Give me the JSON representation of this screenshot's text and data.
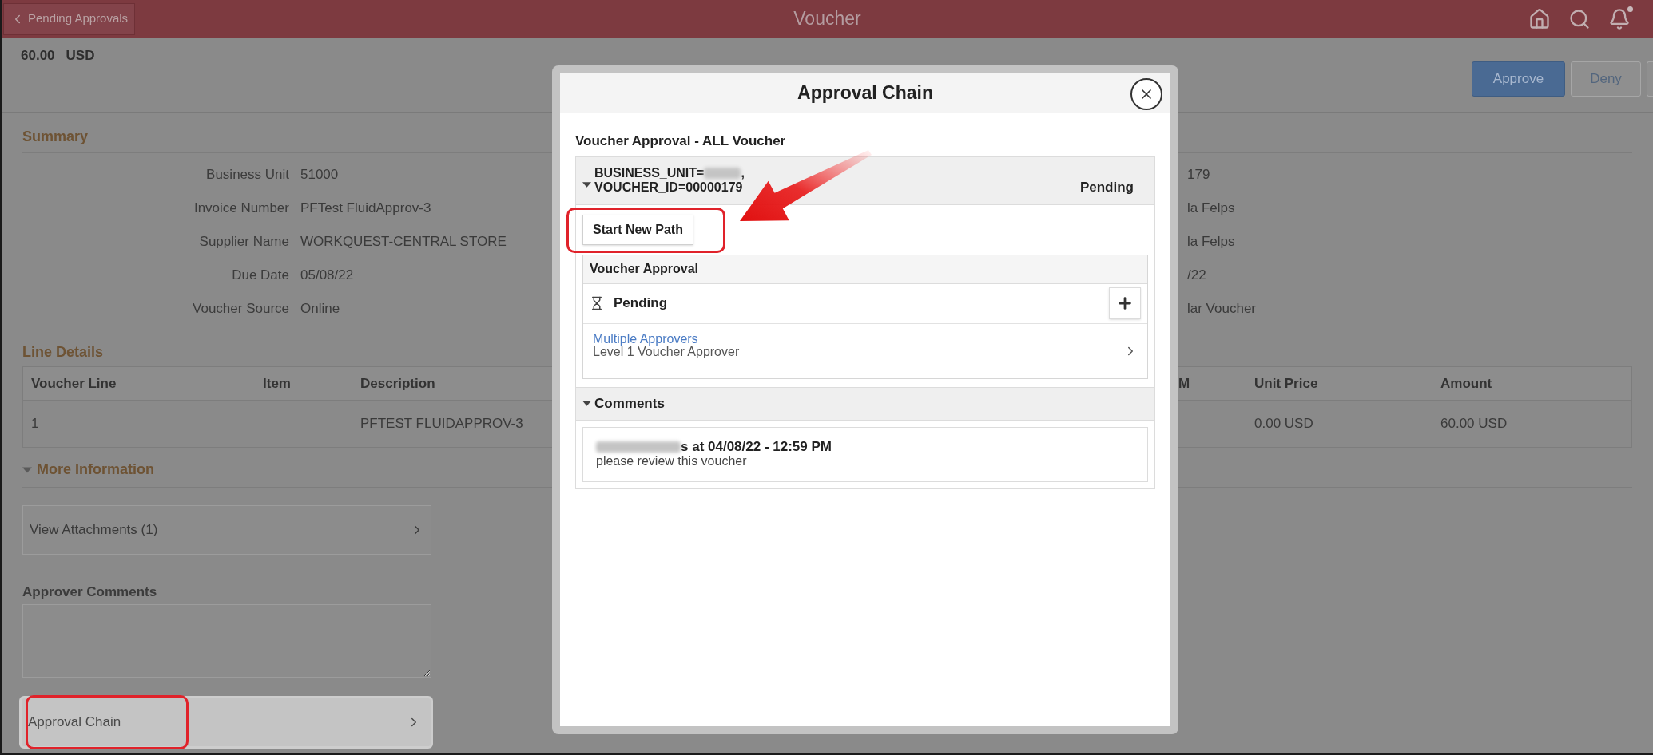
{
  "header": {
    "back_label": "Pending Approvals",
    "title": "Voucher",
    "notification_dot": true
  },
  "amount": {
    "value": "60.00",
    "currency": "USD"
  },
  "actions": [
    {
      "label": "Approve",
      "kind": "primary"
    },
    {
      "label": "Deny",
      "kind": "secondary"
    }
  ],
  "summary": {
    "title": "Summary",
    "fields": [
      {
        "label": "Business Unit",
        "value": "51000",
        "right_value": "179"
      },
      {
        "label": "Invoice Number",
        "value": "PFTest FluidApprov-3",
        "right_value": "la Felps"
      },
      {
        "label": "Supplier Name",
        "value": "WORKQUEST-CENTRAL STORE",
        "right_value": "la Felps"
      },
      {
        "label": "Due Date",
        "value": "05/08/22",
        "right_value": "/22"
      },
      {
        "label": "Voucher Source",
        "value": "Online",
        "right_value": "lar Voucher"
      }
    ]
  },
  "line_details": {
    "title": "Line Details",
    "columns": [
      "Voucher Line",
      "Item",
      "Description",
      "M",
      "Unit Price",
      "Amount"
    ],
    "rows": [
      {
        "voucher_line": "1",
        "description": "PFTEST FLUIDAPPROV-3",
        "unit_price": "0.00 USD",
        "amount": "60.00 USD"
      }
    ]
  },
  "more_information": {
    "title": "More Information",
    "expanded": true,
    "attachments_link": {
      "label": "View Attachments (1)"
    },
    "approver_comments": {
      "label": "Approver Comments"
    },
    "approval_chain_link": {
      "label": "Approval Chain",
      "highlighted": true
    }
  },
  "modal": {
    "title": "Approval Chain",
    "process": "Voucher Approval - ALL Voucher",
    "path": {
      "key_prefix": "BUSINESS_UNIT=",
      "key_suffix": ",",
      "key_line_2": "VOUCHER_ID=00000179",
      "status": "Pending",
      "expanded": true
    },
    "start_button": {
      "label": "Start New Path",
      "highlighted": true
    },
    "stage": {
      "title": "Voucher Approval",
      "step_status": "Pending",
      "approver_link": "Multiple Approvers",
      "approver_role": "Level 1 Voucher Approver"
    },
    "comments": {
      "title": "Comments",
      "expanded": true,
      "items": [
        {
          "author_tail": "s at 04/08/22 - 12:59 PM",
          "text": "please review this voucher"
        }
      ]
    }
  }
}
